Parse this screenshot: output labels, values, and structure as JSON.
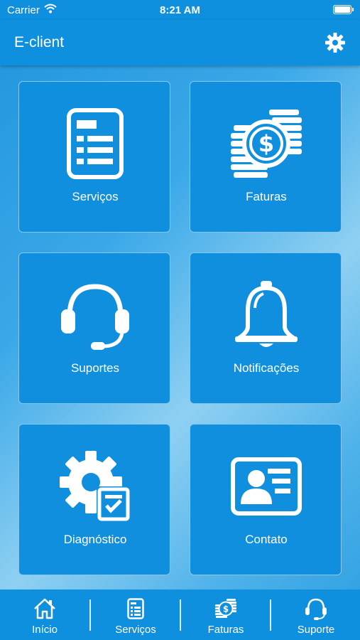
{
  "status_bar": {
    "carrier": "Carrier",
    "time": "8:21 AM"
  },
  "header": {
    "title": "E-client",
    "settings_icon": "gear-icon"
  },
  "tiles": [
    {
      "label": "Serviços",
      "icon": "document-list-icon"
    },
    {
      "label": "Faturas",
      "icon": "coins-dollar-icon"
    },
    {
      "label": "Suportes",
      "icon": "headset-icon"
    },
    {
      "label": "Notificações",
      "icon": "bell-icon"
    },
    {
      "label": "Diagnóstico",
      "icon": "gear-checklist-icon"
    },
    {
      "label": "Contato",
      "icon": "contact-card-icon"
    }
  ],
  "tab_bar": [
    {
      "label": "Início",
      "icon": "home-icon"
    },
    {
      "label": "Serviços",
      "icon": "document-list-icon"
    },
    {
      "label": "Faturas",
      "icon": "coins-dollar-icon"
    },
    {
      "label": "Suporte",
      "icon": "headset-icon"
    }
  ],
  "colors": {
    "primary": "#0e90df",
    "tile": "#0f8fdd",
    "text": "#ffffff"
  }
}
